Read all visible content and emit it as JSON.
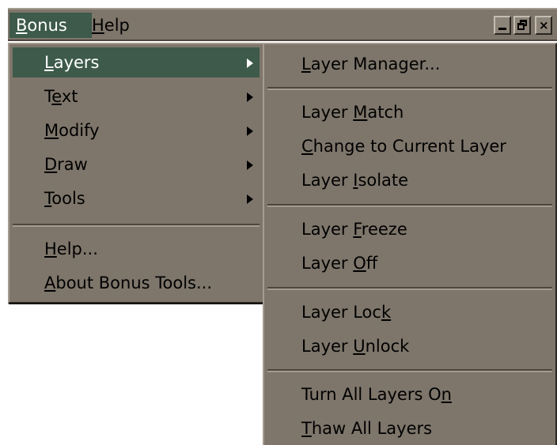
{
  "menubar": {
    "bonus": {
      "pre": "",
      "u": "B",
      "post": "onus"
    },
    "help": {
      "pre": "",
      "u": "H",
      "post": "elp"
    }
  },
  "window_controls": [
    "minimize-icon",
    "restore-icon",
    "close-icon"
  ],
  "main_menu": {
    "layers": {
      "pre": "",
      "u": "L",
      "post": "ayers"
    },
    "text": {
      "pre": "T",
      "u": "e",
      "post": "xt"
    },
    "modify": {
      "pre": "",
      "u": "M",
      "post": "odify"
    },
    "draw": {
      "pre": "",
      "u": "D",
      "post": "raw"
    },
    "tools": {
      "pre": "",
      "u": "T",
      "post": "ools"
    },
    "help": {
      "pre": "",
      "u": "H",
      "post": "elp..."
    },
    "about": {
      "pre": "",
      "u": "A",
      "post": "bout Bonus Tools..."
    }
  },
  "sub_menu": {
    "layer_manager": {
      "pre": "",
      "u": "L",
      "post": "ayer Manager..."
    },
    "layer_match": {
      "pre": "Layer ",
      "u": "M",
      "post": "atch"
    },
    "change_to_current": {
      "pre": "",
      "u": "C",
      "post": "hange to Current Layer"
    },
    "layer_isolate": {
      "pre": "Layer ",
      "u": "I",
      "post": "solate"
    },
    "layer_freeze": {
      "pre": "Layer ",
      "u": "F",
      "post": "reeze"
    },
    "layer_off": {
      "pre": "Layer ",
      "u": "O",
      "post": "ff"
    },
    "layer_lock": {
      "pre": "Layer Loc",
      "u": "k",
      "post": ""
    },
    "layer_unlock": {
      "pre": "Layer ",
      "u": "U",
      "post": "nlock"
    },
    "turn_all_on": {
      "pre": "Turn All Layers O",
      "u": "n",
      "post": ""
    },
    "thaw_all": {
      "pre": "",
      "u": "T",
      "post": "haw All Layers"
    }
  },
  "colors": {
    "menu_bg": "#7e766b",
    "highlight": "#3d5a4a"
  }
}
